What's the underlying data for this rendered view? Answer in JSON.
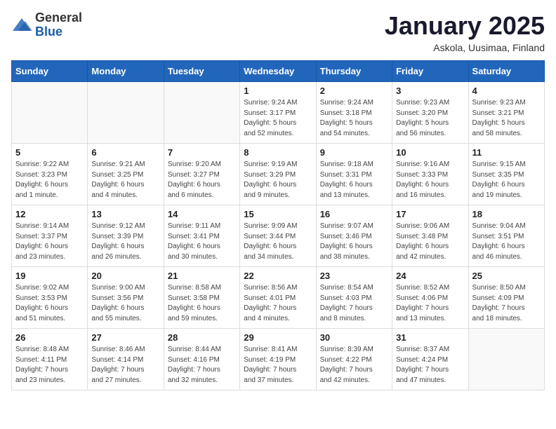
{
  "header": {
    "logo_general": "General",
    "logo_blue": "Blue",
    "month_title": "January 2025",
    "location": "Askola, Uusimaa, Finland"
  },
  "days_of_week": [
    "Sunday",
    "Monday",
    "Tuesday",
    "Wednesday",
    "Thursday",
    "Friday",
    "Saturday"
  ],
  "weeks": [
    [
      {
        "day": "",
        "info": ""
      },
      {
        "day": "",
        "info": ""
      },
      {
        "day": "",
        "info": ""
      },
      {
        "day": "1",
        "info": "Sunrise: 9:24 AM\nSunset: 3:17 PM\nDaylight: 5 hours\nand 52 minutes."
      },
      {
        "day": "2",
        "info": "Sunrise: 9:24 AM\nSunset: 3:18 PM\nDaylight: 5 hours\nand 54 minutes."
      },
      {
        "day": "3",
        "info": "Sunrise: 9:23 AM\nSunset: 3:20 PM\nDaylight: 5 hours\nand 56 minutes."
      },
      {
        "day": "4",
        "info": "Sunrise: 9:23 AM\nSunset: 3:21 PM\nDaylight: 5 hours\nand 58 minutes."
      }
    ],
    [
      {
        "day": "5",
        "info": "Sunrise: 9:22 AM\nSunset: 3:23 PM\nDaylight: 6 hours\nand 1 minute."
      },
      {
        "day": "6",
        "info": "Sunrise: 9:21 AM\nSunset: 3:25 PM\nDaylight: 6 hours\nand 4 minutes."
      },
      {
        "day": "7",
        "info": "Sunrise: 9:20 AM\nSunset: 3:27 PM\nDaylight: 6 hours\nand 6 minutes."
      },
      {
        "day": "8",
        "info": "Sunrise: 9:19 AM\nSunset: 3:29 PM\nDaylight: 6 hours\nand 9 minutes."
      },
      {
        "day": "9",
        "info": "Sunrise: 9:18 AM\nSunset: 3:31 PM\nDaylight: 6 hours\nand 13 minutes."
      },
      {
        "day": "10",
        "info": "Sunrise: 9:16 AM\nSunset: 3:33 PM\nDaylight: 6 hours\nand 16 minutes."
      },
      {
        "day": "11",
        "info": "Sunrise: 9:15 AM\nSunset: 3:35 PM\nDaylight: 6 hours\nand 19 minutes."
      }
    ],
    [
      {
        "day": "12",
        "info": "Sunrise: 9:14 AM\nSunset: 3:37 PM\nDaylight: 6 hours\nand 23 minutes."
      },
      {
        "day": "13",
        "info": "Sunrise: 9:12 AM\nSunset: 3:39 PM\nDaylight: 6 hours\nand 26 minutes."
      },
      {
        "day": "14",
        "info": "Sunrise: 9:11 AM\nSunset: 3:41 PM\nDaylight: 6 hours\nand 30 minutes."
      },
      {
        "day": "15",
        "info": "Sunrise: 9:09 AM\nSunset: 3:44 PM\nDaylight: 6 hours\nand 34 minutes."
      },
      {
        "day": "16",
        "info": "Sunrise: 9:07 AM\nSunset: 3:46 PM\nDaylight: 6 hours\nand 38 minutes."
      },
      {
        "day": "17",
        "info": "Sunrise: 9:06 AM\nSunset: 3:48 PM\nDaylight: 6 hours\nand 42 minutes."
      },
      {
        "day": "18",
        "info": "Sunrise: 9:04 AM\nSunset: 3:51 PM\nDaylight: 6 hours\nand 46 minutes."
      }
    ],
    [
      {
        "day": "19",
        "info": "Sunrise: 9:02 AM\nSunset: 3:53 PM\nDaylight: 6 hours\nand 51 minutes."
      },
      {
        "day": "20",
        "info": "Sunrise: 9:00 AM\nSunset: 3:56 PM\nDaylight: 6 hours\nand 55 minutes."
      },
      {
        "day": "21",
        "info": "Sunrise: 8:58 AM\nSunset: 3:58 PM\nDaylight: 6 hours\nand 59 minutes."
      },
      {
        "day": "22",
        "info": "Sunrise: 8:56 AM\nSunset: 4:01 PM\nDaylight: 7 hours\nand 4 minutes."
      },
      {
        "day": "23",
        "info": "Sunrise: 8:54 AM\nSunset: 4:03 PM\nDaylight: 7 hours\nand 8 minutes."
      },
      {
        "day": "24",
        "info": "Sunrise: 8:52 AM\nSunset: 4:06 PM\nDaylight: 7 hours\nand 13 minutes."
      },
      {
        "day": "25",
        "info": "Sunrise: 8:50 AM\nSunset: 4:09 PM\nDaylight: 7 hours\nand 18 minutes."
      }
    ],
    [
      {
        "day": "26",
        "info": "Sunrise: 8:48 AM\nSunset: 4:11 PM\nDaylight: 7 hours\nand 23 minutes."
      },
      {
        "day": "27",
        "info": "Sunrise: 8:46 AM\nSunset: 4:14 PM\nDaylight: 7 hours\nand 27 minutes."
      },
      {
        "day": "28",
        "info": "Sunrise: 8:44 AM\nSunset: 4:16 PM\nDaylight: 7 hours\nand 32 minutes."
      },
      {
        "day": "29",
        "info": "Sunrise: 8:41 AM\nSunset: 4:19 PM\nDaylight: 7 hours\nand 37 minutes."
      },
      {
        "day": "30",
        "info": "Sunrise: 8:39 AM\nSunset: 4:22 PM\nDaylight: 7 hours\nand 42 minutes."
      },
      {
        "day": "31",
        "info": "Sunrise: 8:37 AM\nSunset: 4:24 PM\nDaylight: 7 hours\nand 47 minutes."
      },
      {
        "day": "",
        "info": ""
      }
    ]
  ]
}
